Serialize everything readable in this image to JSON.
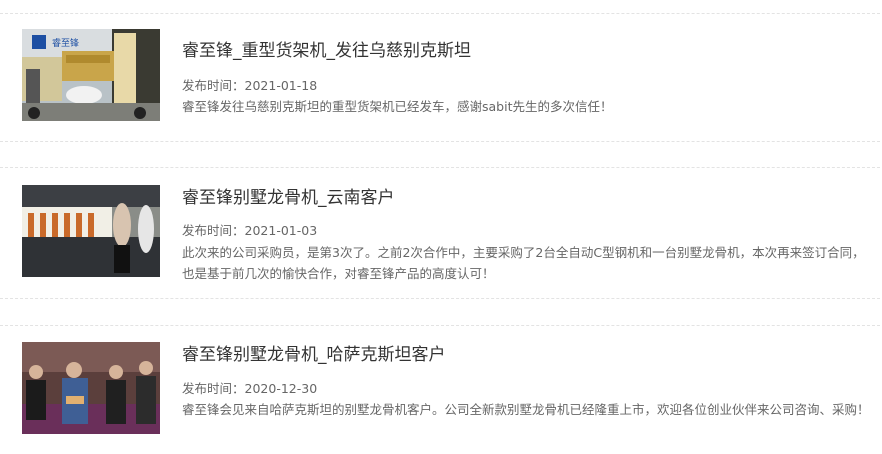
{
  "articles": [
    {
      "title": "睿至锋_重型货架机_发往乌慈别克斯坦",
      "date_prefix": "发布时间：",
      "date": "2021-01-18",
      "summary": "睿至锋发往乌慈别克斯坦的重型货架机已经发车，感谢sabit先生的多次信任！",
      "image_icon": "truck-loading-photo",
      "image_text": "睿至锋"
    },
    {
      "title": "睿至锋别墅龙骨机_云南客户",
      "date_prefix": "发布时间：",
      "date": "2021-01-03",
      "summary": "此次来的公司采购员，是第3次了。之前2次合作中，主要采购了2台全自动C型钢机和一台别墅龙骨机，本次再来签订合同，也是基于前几次的愉快合作，对睿至锋产品的高度认可！",
      "image_icon": "factory-visit-photo"
    },
    {
      "title": "睿至锋别墅龙骨机_哈萨克斯坦客户",
      "date_prefix": "发布时间：",
      "date": "2020-12-30",
      "summary": "睿至锋会见来自哈萨克斯坦的别墅龙骨机客户。公司全新款别墅龙骨机已经隆重上市，欢迎各位创业伙伴来公司咨询、采购！",
      "image_icon": "group-photo"
    }
  ]
}
